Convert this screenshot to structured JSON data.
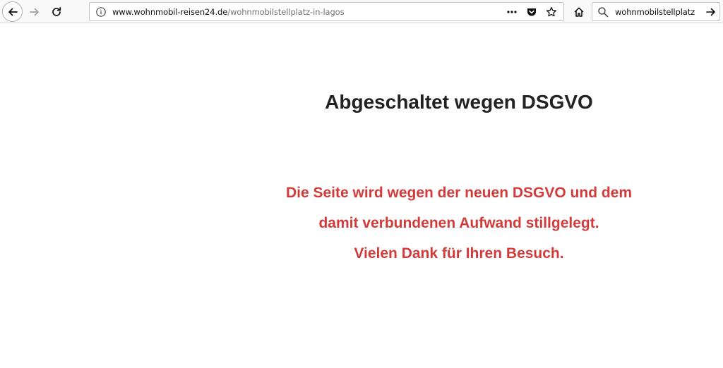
{
  "browser": {
    "url_domain": "www.wohnmobil-reisen24.de",
    "url_path": "/wohnmobilstellplatz-in-lagos",
    "search_value": "wohnmobilstellplatz"
  },
  "page": {
    "heading": "Abgeschaltet wegen DSGVO",
    "message_lines": [
      "Die Seite wird wegen der neuen DSGVO und dem",
      "damit verbundenen Aufwand stillgelegt.",
      "Vielen Dank für Ihren Besuch."
    ]
  },
  "colors": {
    "heading": "#222222",
    "message": "#d33b3b"
  }
}
